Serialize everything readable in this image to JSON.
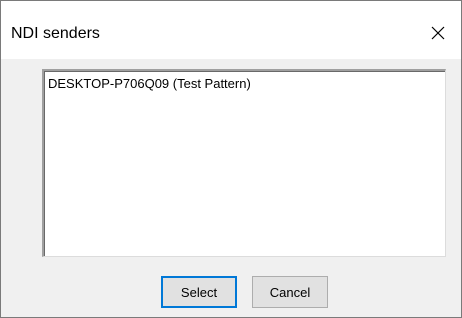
{
  "window": {
    "title": "NDI senders",
    "close_icon": "close-icon"
  },
  "list": {
    "items": [
      "DESKTOP-P706Q09 (Test Pattern)"
    ]
  },
  "buttons": {
    "select_label": "Select",
    "cancel_label": "Cancel"
  },
  "colors": {
    "title_bar": "#ffffff",
    "dialog_bg": "#f0f0f0",
    "default_button_border": "#0078d7"
  }
}
